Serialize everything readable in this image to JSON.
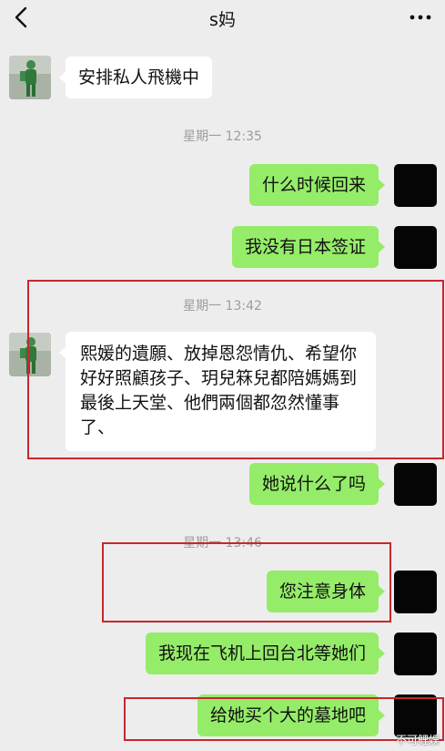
{
  "header": {
    "title": "s妈",
    "back_icon": "chevron-left-icon",
    "more_icon": "more-dots-icon"
  },
  "messages": [
    {
      "side": "left",
      "text": "安排私人飛機中"
    },
    {
      "side": "timestamp",
      "text": "星期一 12:35"
    },
    {
      "side": "right",
      "text": "什么时候回来"
    },
    {
      "side": "right",
      "text": "我没有日本签证"
    },
    {
      "side": "timestamp",
      "text": "星期一 13:42"
    },
    {
      "side": "left",
      "text": "熙媛的遺願、放掉恩怨情仇、希望你好好照顧孩子、玥兒箖兒都陪媽媽到最後上天堂、他們兩個都忽然懂事了、"
    },
    {
      "side": "right",
      "text": "她说什么了吗"
    },
    {
      "side": "timestamp",
      "text": "星期一 13:46"
    },
    {
      "side": "right",
      "text": "您注意身体"
    },
    {
      "side": "right",
      "text": "我现在飞机上回台北等她们"
    },
    {
      "side": "right",
      "text": "给她买个大的墓地吧"
    }
  ],
  "watermark": "不可鲤娱",
  "colors": {
    "background": "#ededed",
    "bubble_self": "#95ec69",
    "bubble_other": "#ffffff",
    "highlight_box": "#c8262d",
    "timestamp": "#9d9d9d"
  }
}
